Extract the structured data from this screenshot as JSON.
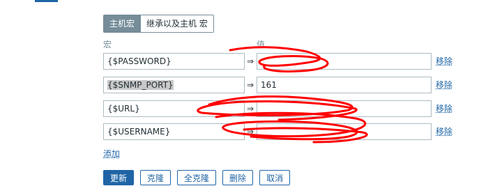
{
  "tabs": [
    "主机宏",
    "继承以及主机 宏"
  ],
  "columns": {
    "macro": "宏",
    "value": "值"
  },
  "arrow": "⇒",
  "macros": [
    {
      "name": "{$PASSWORD}",
      "value": "",
      "selected": false
    },
    {
      "name": "{$SNMP_PORT}",
      "value": "161",
      "selected": true
    },
    {
      "name": "{$URL}",
      "value": "",
      "selected": false
    },
    {
      "name": "{$USERNAME}",
      "value": "",
      "selected": false
    }
  ],
  "remove_label": "移除",
  "add_label": "添加",
  "buttons": {
    "update": "更新",
    "clone": "克隆",
    "full_clone": "全克隆",
    "delete": "删除",
    "cancel": "取消"
  },
  "colors": {
    "accent": "#1f65a6",
    "redaction": "#ff0000"
  }
}
